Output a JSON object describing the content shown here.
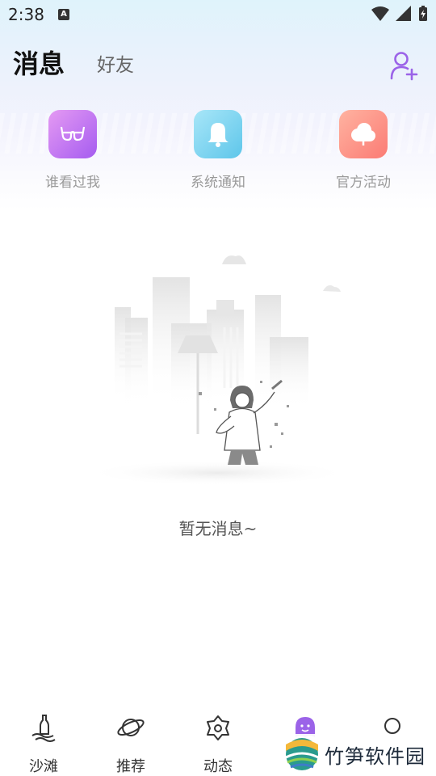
{
  "status_bar": {
    "time": "2:38",
    "notification_glyph": "A"
  },
  "header": {
    "active_tab": "消息",
    "inactive_tab": "好友",
    "add_friend_icon": "add-user-icon"
  },
  "quick_entries": [
    {
      "label": "谁看过我",
      "icon": "glasses-icon",
      "color": "#b96cf2"
    },
    {
      "label": "系统通知",
      "icon": "bell-icon",
      "color": "#6fcdee"
    },
    {
      "label": "官方活动",
      "icon": "cloud-icon",
      "color": "#fc8a7c"
    }
  ],
  "empty_state": {
    "message": "暂无消息~"
  },
  "bottom_nav": [
    {
      "label": "沙滩",
      "icon": "bottle-icon"
    },
    {
      "label": "推荐",
      "icon": "planet-icon"
    },
    {
      "label": "动态",
      "icon": "flower-icon"
    },
    {
      "label": "",
      "icon": "ghost-icon"
    },
    {
      "label": "",
      "icon": "circle-icon"
    }
  ],
  "watermark": {
    "text": "竹笋软件园"
  },
  "colors": {
    "accent": "#9b63e8",
    "text_muted": "#9a9a9a"
  }
}
